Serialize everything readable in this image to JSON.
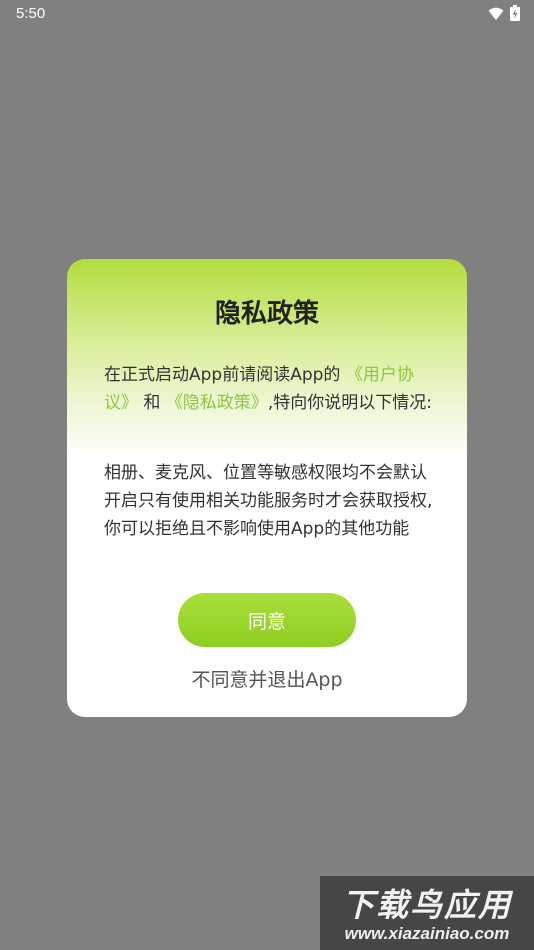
{
  "status_bar": {
    "time": "5:50",
    "icons": [
      "wifi-icon",
      "battery-charging-icon"
    ]
  },
  "dialog": {
    "title": "隐私政策",
    "intro_prefix": "在正式启动App前请阅读App的",
    "user_agreement_link": "《用户协议》",
    "intro_and": " 和 ",
    "privacy_policy_link": "《隐私政策》",
    "intro_suffix": ",特向你说明以下情况:",
    "body": "相册、麦克风、位置等敏感权限均不会默认开启只有使用相关功能服务时才会获取授权,你可以拒绝且不影响使用App的其他功能",
    "agree_label": "同意",
    "disagree_label": "不同意并退出App"
  },
  "watermark": {
    "title": "下载鸟应用",
    "url": "www.xiazainiao.com"
  },
  "colors": {
    "backdrop": "#808080",
    "accent_green": "#8cc63f",
    "button_green": "#9ad62c"
  }
}
